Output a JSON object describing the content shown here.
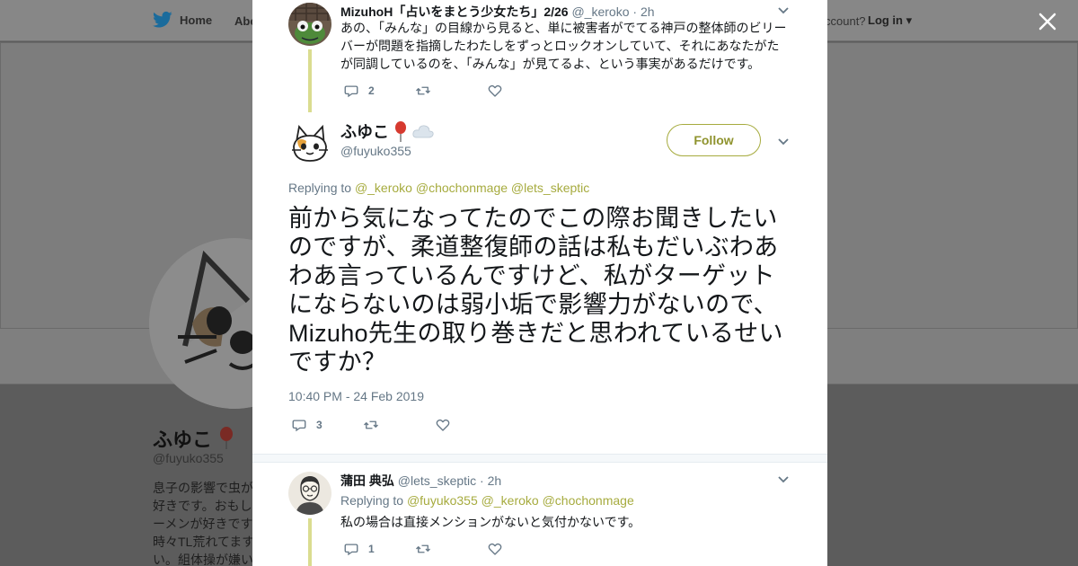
{
  "background_page": {
    "nav": {
      "home_label": "Home",
      "about_label": "Abo",
      "account_question": "ccount?",
      "login_label": "Log in"
    },
    "profile": {
      "name": "ふゆこ",
      "handle": "@fuyuko355",
      "bio_lines": [
        "息子の影響で虫が",
        "好きです。おもし",
        "ーメンが好きです",
        "時々TL荒れてます",
        "い。組体操が嫌い"
      ]
    }
  },
  "modal": {
    "parent_tweet": {
      "name": "MizuhoH「占いをまとう少女たち」2/26",
      "handle": "@_keroko",
      "time": "· 2h",
      "text": "あの、「みんな」の目線から見ると、単に被害者がでてる神戸の整体師のビリーバーが問題を指摘したわたしをずっとロックオンしていて、それにあなたがたが同調しているのを、「みんな」が見てるよ、という事実があるだけです。",
      "reply_count": "2",
      "retweet_count": "",
      "like_count": ""
    },
    "main_tweet": {
      "name": "ふゆこ",
      "handle": "@fuyuko355",
      "follow_label": "Follow",
      "replying_to_label": "Replying to",
      "mentions": [
        "@_keroko",
        "@chochonmage",
        "@lets_skeptic"
      ],
      "text": "前から気になってたのでこの際お聞きしたいのですが、柔道整復師の話は私もだいぶわあわあ言っているんですけど、私がターゲットにならないのは弱小垢で影響力がないので、Mizuho先生の取り巻きだと思われているせいですか？",
      "timestamp": "10:40 PM - 24 Feb 2019",
      "reply_count": "3",
      "retweet_count": "",
      "like_count": ""
    },
    "reply_tweet": {
      "name": "蒲田 典弘",
      "handle": "@lets_skeptic",
      "time": "· 2h",
      "replying_to_label": "Replying to",
      "mentions": [
        "@fuyuko355",
        "@_keroko",
        "@chochonmage"
      ],
      "text": "私の場合は直接メンションがないと気付かないです。",
      "reply_count": "1",
      "retweet_count": "",
      "like_count": ""
    }
  },
  "icons": {
    "twitter": "twitter-bird-icon",
    "close": "close-icon",
    "reply": "reply-icon",
    "retweet": "retweet-icon",
    "like": "heart-icon",
    "caret": "chevron-down-icon",
    "balloon": "balloon-emoji-icon",
    "cloud": "cloud-emoji-icon"
  },
  "colors": {
    "accent": "#a6ab3e",
    "twitter_blue": "#1da1f2",
    "text_secondary": "#657786",
    "overlay_bg": "#5c5c5c",
    "thread_line": "#dadc90"
  }
}
